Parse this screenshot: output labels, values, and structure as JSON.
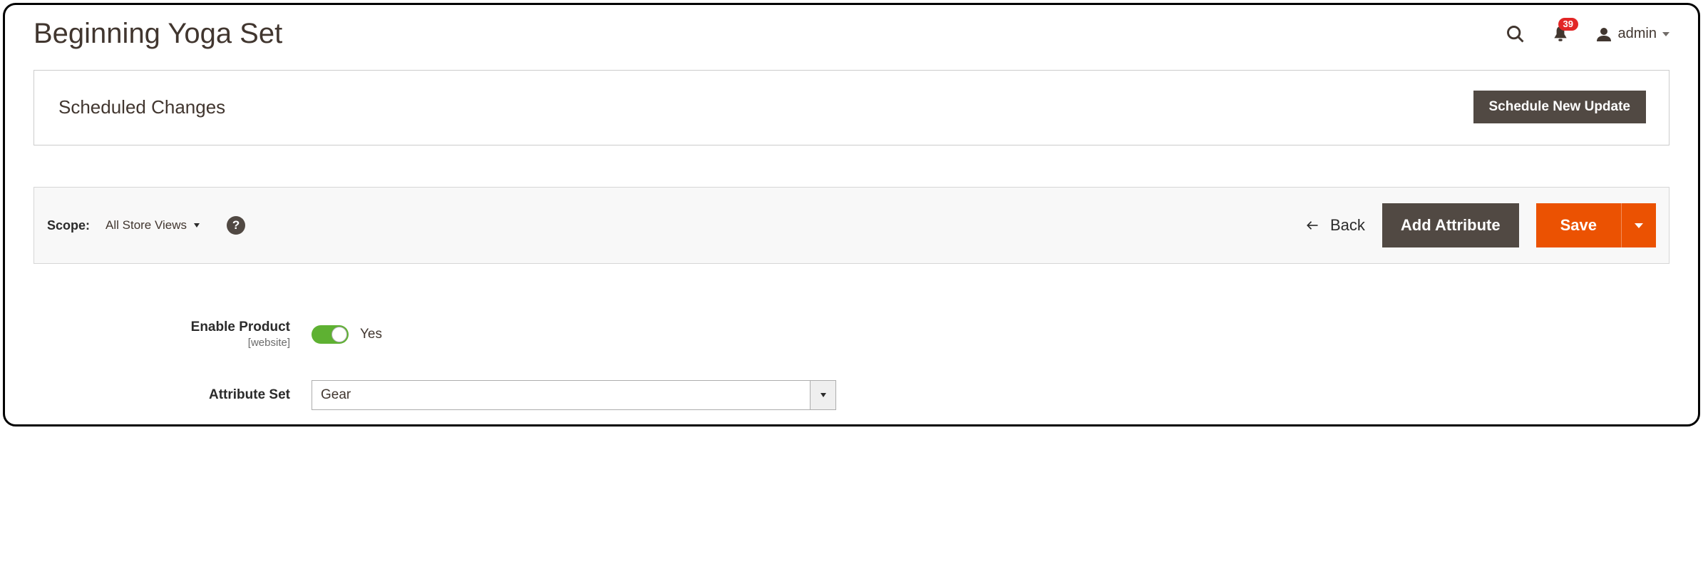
{
  "header": {
    "title": "Beginning Yoga Set",
    "notification_count": "39",
    "user_name": "admin"
  },
  "scheduled_panel": {
    "title": "Scheduled Changes",
    "button": "Schedule New Update"
  },
  "toolbar": {
    "scope_label": "Scope:",
    "scope_value": "All Store Views",
    "back_label": "Back",
    "add_attribute_label": "Add Attribute",
    "save_label": "Save"
  },
  "form": {
    "enable_product": {
      "label": "Enable Product",
      "sublabel": "[website]",
      "value_label": "Yes"
    },
    "attribute_set": {
      "label": "Attribute Set",
      "value": "Gear"
    }
  }
}
